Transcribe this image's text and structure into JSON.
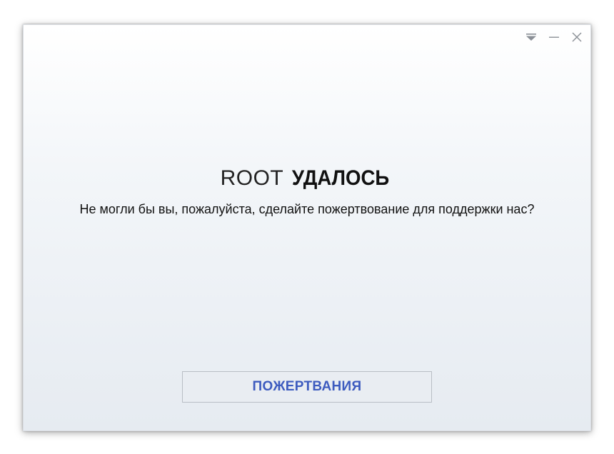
{
  "window": {
    "controls": {
      "menu_icon": "dropdown-triangle-icon",
      "minimize_icon": "minimize-icon",
      "close_icon": "close-icon"
    }
  },
  "main": {
    "title_prefix": "ROOT",
    "title_main": "УДАЛОСЬ",
    "subtitle": "Не могли бы вы, пожалуйста, сделайте пожертвование для поддержки нас?",
    "donate_button_label": "ПОЖЕРТВАНИЯ"
  },
  "colors": {
    "button_text": "#3d5bbf",
    "button_border": "#b9bec5",
    "background_top": "#ffffff",
    "background_bottom": "#e6ebf1"
  }
}
